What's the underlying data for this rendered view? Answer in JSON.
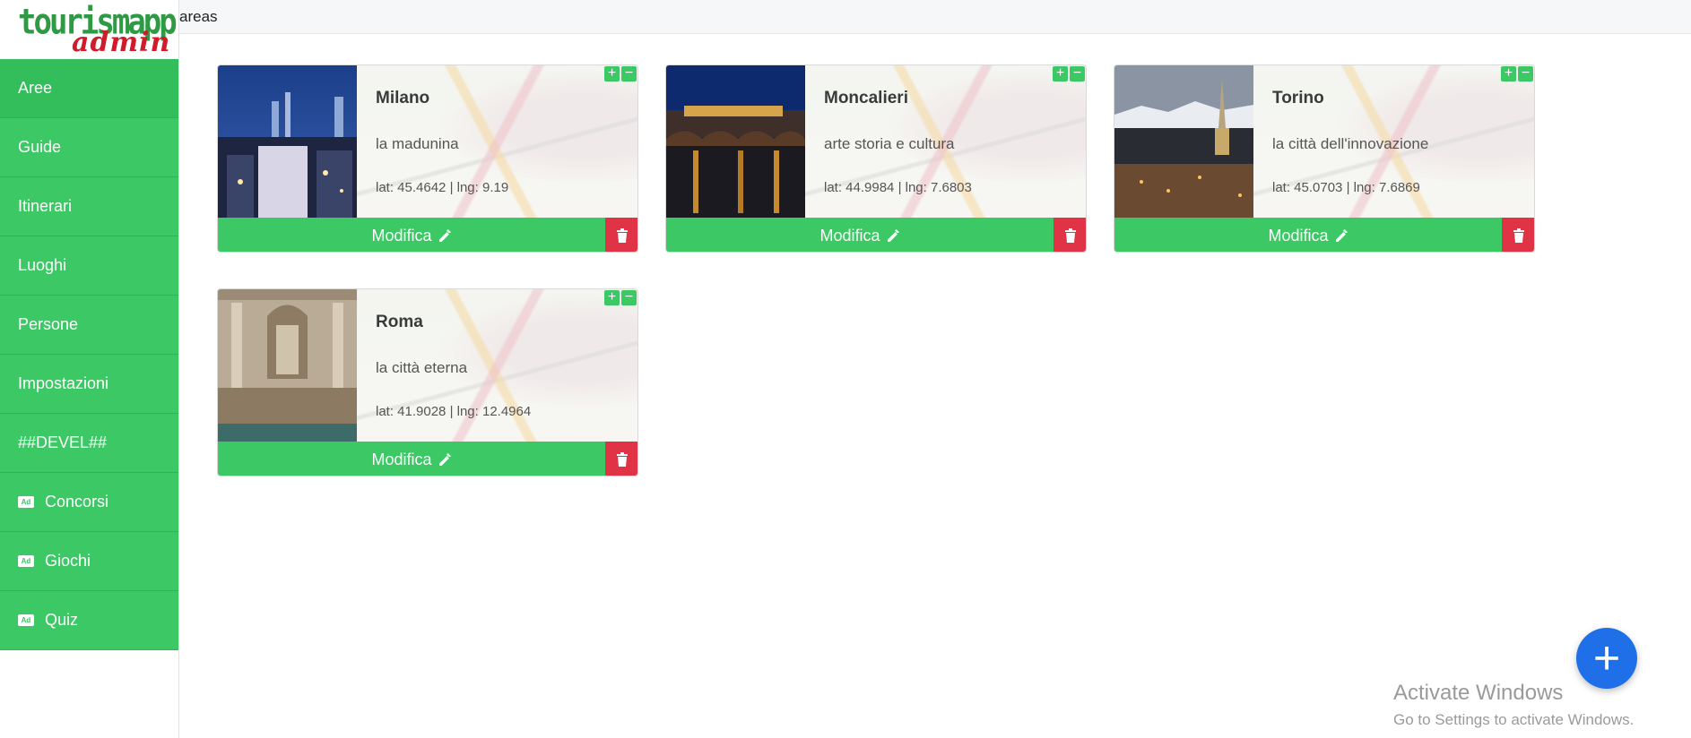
{
  "logo": {
    "top": "tourismapp",
    "bottom": "admin"
  },
  "topbar": {
    "title": "areas"
  },
  "sidebar": {
    "items": [
      {
        "label": "Aree",
        "icon": "",
        "active": true
      },
      {
        "label": "Guide",
        "icon": ""
      },
      {
        "label": "Itinerari",
        "icon": ""
      },
      {
        "label": "Luoghi",
        "icon": ""
      },
      {
        "label": "Persone",
        "icon": ""
      },
      {
        "label": "Impostazioni",
        "icon": ""
      },
      {
        "label": "##DEVEL##",
        "icon": ""
      },
      {
        "label": "Concorsi",
        "icon": "ad-icon"
      },
      {
        "label": "Giochi",
        "icon": "ad-icon"
      },
      {
        "label": "Quiz",
        "icon": "ad-icon"
      }
    ]
  },
  "cards": [
    {
      "name": "Milano",
      "desc": "la madunina",
      "coords": "lat: 45.4642 | lng: 9.19",
      "edit_label": "Modifica"
    },
    {
      "name": "Moncalieri",
      "desc": "arte storia e cultura",
      "coords": "lat: 44.9984 | lng: 7.6803",
      "edit_label": "Modifica"
    },
    {
      "name": "Torino",
      "desc": "la città dell'innovazione",
      "coords": "lat: 45.0703 | lng: 7.6869",
      "edit_label": "Modifica"
    },
    {
      "name": "Roma",
      "desc": "la città eterna",
      "coords": "lat: 41.9028 | lng: 12.4964",
      "edit_label": "Modifica"
    }
  ],
  "fab": {
    "label": "+"
  },
  "watermark": {
    "line1": "Activate Windows",
    "line2": "Go to Settings to activate Windows."
  },
  "colors": {
    "accent": "#3cc864",
    "danger": "#e03345",
    "fab": "#1f6fe8"
  }
}
